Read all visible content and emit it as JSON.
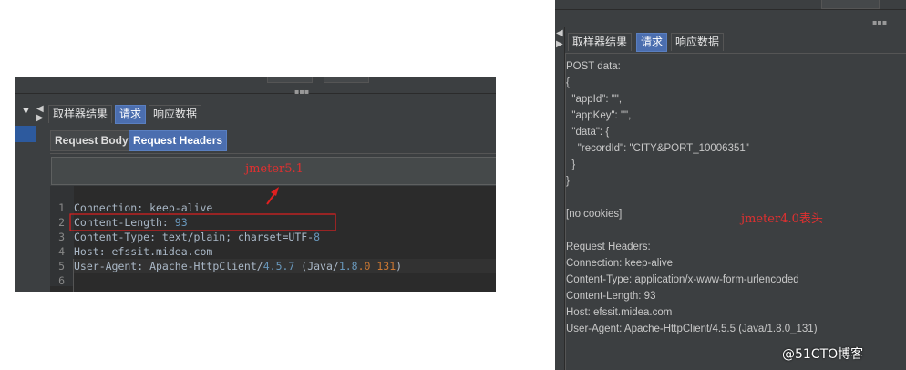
{
  "left_panel": {
    "tabs": [
      "取样器结果",
      "请求",
      "响应数据"
    ],
    "active_tab": "请求",
    "subtabs": [
      "Request Body",
      "Request Headers"
    ],
    "active_subtab": "Request Headers",
    "annotation": "jmeter5.1",
    "lines": [
      {
        "n": "1",
        "text": "Connection: keep-alive"
      },
      {
        "n": "2",
        "key": "Content-Length: ",
        "num": "93"
      },
      {
        "n": "3",
        "text": "Content-Type: text/plain; charset=UTF-",
        "num": "8"
      },
      {
        "n": "4",
        "text": "Host: efssit.midea.com"
      },
      {
        "n": "5",
        "k1": "User-Agent: Apache-HttpClient/",
        "v1": "4.5.7",
        "k2": " (Java/",
        "v2": "1.8",
        "v3": ".0_131",
        "k3": ")"
      },
      {
        "n": "6",
        "text": ""
      }
    ]
  },
  "right_panel": {
    "tabs": [
      "取样器结果",
      "请求",
      "响应数据"
    ],
    "active_tab": "请求",
    "annotation": "jmeter4.0表头",
    "lines": [
      "POST data:",
      "{",
      "  \"appId\": \"\",",
      "  \"appKey\": \"\",",
      "  \"data\": {",
      "    \"recordId\": \"CITY&PORT_10006351\"",
      "  }",
      "}",
      "",
      "[no cookies]",
      "",
      "Request Headers:",
      "Connection: keep-alive",
      "Content-Type: application/x-www-form-urlencoded",
      "Content-Length: 93",
      "Host: efssit.midea.com",
      "User-Agent: Apache-HttpClient/4.5.5 (Java/1.8.0_131)"
    ]
  },
  "watermark": "@51CTO博客",
  "colors": {
    "annotation": "#e03030",
    "active_tab": "#4b6eaf",
    "panel_bg": "#3c3f41",
    "editor_bg": "#2b2b2b"
  }
}
